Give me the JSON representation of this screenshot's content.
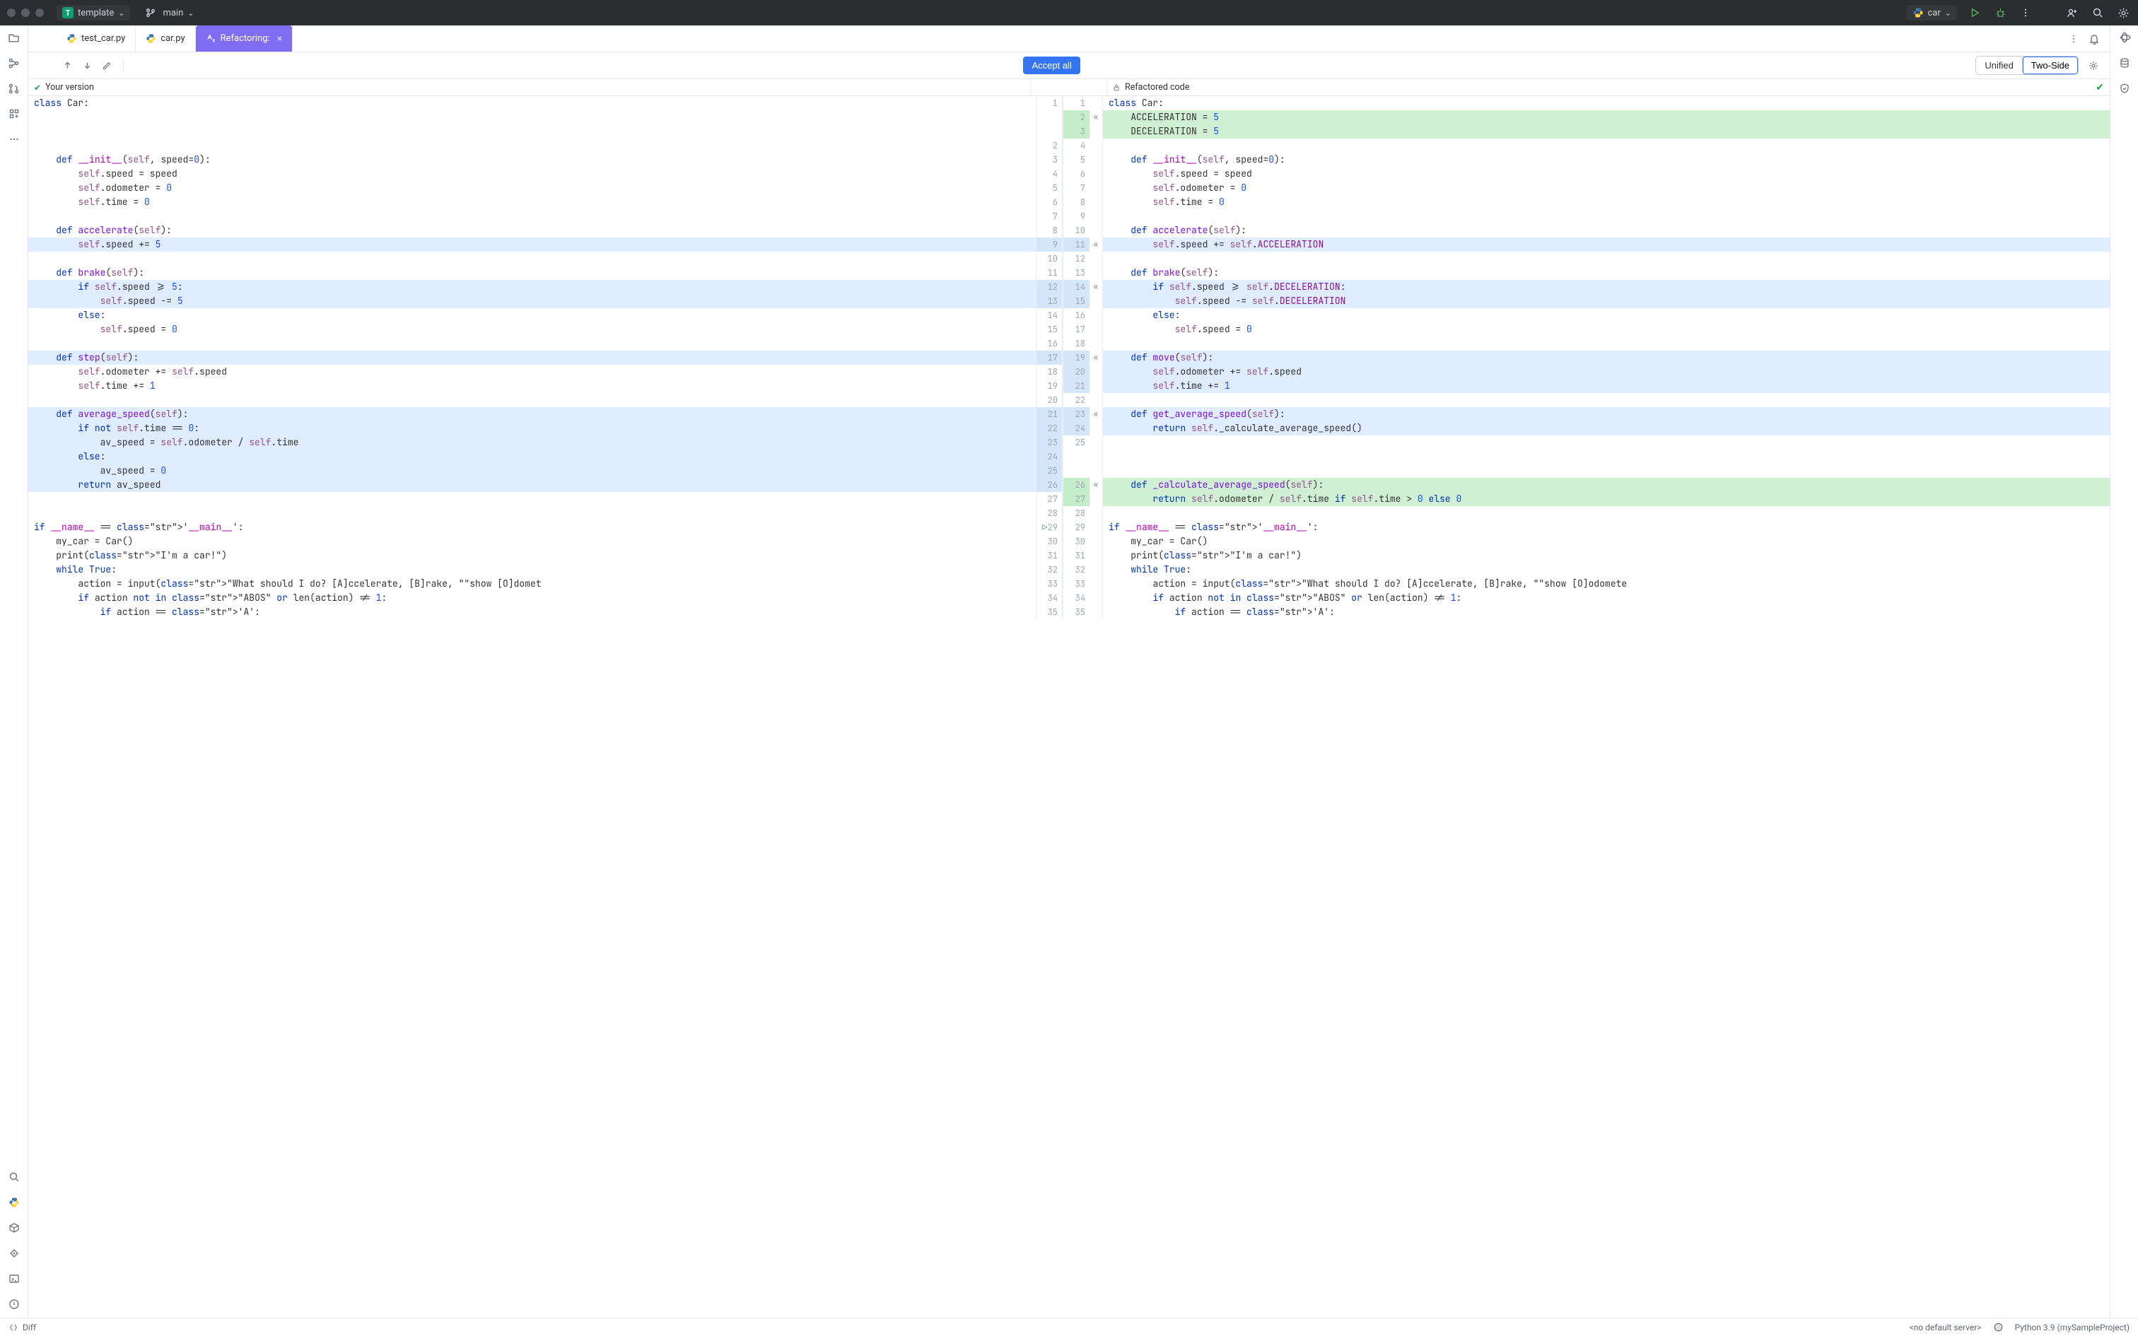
{
  "titlebar": {
    "project_initial": "T",
    "project_name": "template",
    "branch_name": "main",
    "run_config": "car"
  },
  "tabs": {
    "tab1": "test_car.py",
    "tab2": "car.py",
    "tab3": "Refactoring:"
  },
  "difftoolbar": {
    "accept": "Accept all",
    "unified": "Unified",
    "twoside": "Two-Side"
  },
  "diffheader": {
    "left": "Your version",
    "right": "Refactored code"
  },
  "statusbar": {
    "toolwin": "Diff",
    "server": "<no default server>",
    "interpreter": "Python 3.9 (mySampleProject)"
  },
  "left_lines": {
    "1": "class Car:",
    "2": "",
    "3": "    def __init__(self, speed=0):",
    "4": "        self.speed = speed",
    "5": "        self.odometer = 0",
    "6": "        self.time = 0",
    "7": "",
    "8": "    def accelerate(self):",
    "9": "        self.speed += 5",
    "10": "",
    "11": "    def brake(self):",
    "12": "        if self.speed >= 5:",
    "13": "            self.speed -= 5",
    "14": "        else:",
    "15": "            self.speed = 0",
    "16": "",
    "17": "    def step(self):",
    "18": "        self.odometer += self.speed",
    "19": "        self.time += 1",
    "20": "",
    "21": "    def average_speed(self):",
    "22": "        if not self.time == 0:",
    "23": "            av_speed = self.odometer / self.time",
    "24": "        else:",
    "25": "            av_speed = 0",
    "26": "        return av_speed",
    "27": "",
    "28": "",
    "29": "if __name__ == '__main__':",
    "30": "    my_car = Car()",
    "31": "    print(\"I'm a car!\")",
    "32": "    while True:",
    "33": "        action = input(\"What should I do? [A]ccelerate, [B]rake, \"\"show [O]domet",
    "34": "        if action not in \"ABOS\" or len(action) != 1:",
    "35": "            if action == 'A':"
  },
  "right_lines": {
    "1": "class Car:",
    "2": "    ACCELERATION = 5",
    "3": "    DECELERATION = 5",
    "4": "",
    "5": "    def __init__(self, speed=0):",
    "6": "        self.speed = speed",
    "7": "        self.odometer = 0",
    "8": "        self.time = 0",
    "9": "",
    "10": "    def accelerate(self):",
    "11": "        self.speed += self.ACCELERATION",
    "12": "",
    "13": "    def brake(self):",
    "14": "        if self.speed >= self.DECELERATION:",
    "15": "            self.speed -= self.DECELERATION",
    "16": "        else:",
    "17": "            self.speed = 0",
    "18": "",
    "19": "    def move(self):",
    "20": "        self.odometer += self.speed",
    "21": "        self.time += 1",
    "22": "",
    "23": "    def get_average_speed(self):",
    "24": "        return self._calculate_average_speed()",
    "25": "",
    "26": "    def _calculate_average_speed(self):",
    "27": "        return self.odometer / self.time if self.time > 0 else 0",
    "28": "",
    "29": "if __name__ == '__main__':",
    "30": "    my_car = Car()",
    "31": "    print(\"I'm a car!\")",
    "32": "    while True:",
    "33": "        action = input(\"What should I do? [A]ccelerate, [B]rake, \"\"show [O]odomete",
    "34": "        if action not in \"ABOS\" or len(action) != 1:",
    "35": "            if action == 'A':"
  },
  "rows": [
    {
      "l": 1,
      "r": 1,
      "lh": "",
      "rh": ""
    },
    {
      "l": "",
      "r": 2,
      "lh": "",
      "rh": "G",
      "arrow": "«"
    },
    {
      "l": "",
      "r": 3,
      "lh": "",
      "rh": "G"
    },
    {
      "l": 2,
      "r": 4,
      "lh": "",
      "rh": ""
    },
    {
      "l": 3,
      "r": 5,
      "lh": "",
      "rh": ""
    },
    {
      "l": 4,
      "r": 6,
      "lh": "",
      "rh": ""
    },
    {
      "l": 5,
      "r": 7,
      "lh": "",
      "rh": ""
    },
    {
      "l": 6,
      "r": 8,
      "lh": "",
      "rh": ""
    },
    {
      "l": 7,
      "r": 9,
      "lh": "",
      "rh": ""
    },
    {
      "l": 8,
      "r": 10,
      "lh": "",
      "rh": ""
    },
    {
      "l": 9,
      "r": 11,
      "lh": "B",
      "rh": "B",
      "arrow": "«"
    },
    {
      "l": 10,
      "r": 12,
      "lh": "",
      "rh": ""
    },
    {
      "l": 11,
      "r": 13,
      "lh": "",
      "rh": ""
    },
    {
      "l": 12,
      "r": 14,
      "lh": "B",
      "rh": "B",
      "arrow": "«"
    },
    {
      "l": 13,
      "r": 15,
      "lh": "B",
      "rh": "B"
    },
    {
      "l": 14,
      "r": 16,
      "lh": "",
      "rh": ""
    },
    {
      "l": 15,
      "r": 17,
      "lh": "",
      "rh": ""
    },
    {
      "l": 16,
      "r": 18,
      "lh": "",
      "rh": ""
    },
    {
      "l": 17,
      "r": 19,
      "lh": "B",
      "rh": "B",
      "arrow": "«"
    },
    {
      "l": 18,
      "r": 20,
      "lh": "",
      "rh": "B"
    },
    {
      "l": 19,
      "r": 21,
      "lh": "",
      "rh": "B"
    },
    {
      "l": 20,
      "r": 22,
      "lh": "",
      "rh": ""
    },
    {
      "l": 21,
      "r": 23,
      "lh": "B",
      "rh": "B",
      "arrow": "«"
    },
    {
      "l": 22,
      "r": 24,
      "lh": "B",
      "rh": "B"
    },
    {
      "l": 23,
      "r": 25,
      "lh": "B",
      "rh": ""
    },
    {
      "l": 24,
      "r": "",
      "lh": "B",
      "rh": ""
    },
    {
      "l": 25,
      "r": "",
      "lh": "B",
      "rh": ""
    },
    {
      "l": 26,
      "r": 26,
      "lh": "B",
      "rh": "G",
      "arrow": "«"
    },
    {
      "l": 27,
      "r": 27,
      "lh": "",
      "rh": "G"
    },
    {
      "l": 28,
      "r": 28,
      "lh": "",
      "rh": ""
    },
    {
      "l": 29,
      "r": 29,
      "lh": "",
      "rh": "",
      "run": true
    },
    {
      "l": 30,
      "r": 30,
      "lh": "",
      "rh": ""
    },
    {
      "l": 31,
      "r": 31,
      "lh": "",
      "rh": ""
    },
    {
      "l": 32,
      "r": 32,
      "lh": "",
      "rh": ""
    },
    {
      "l": 33,
      "r": 33,
      "lh": "",
      "rh": ""
    },
    {
      "l": 34,
      "r": 34,
      "lh": "",
      "rh": ""
    },
    {
      "l": 35,
      "r": 35,
      "lh": "",
      "rh": ""
    }
  ]
}
